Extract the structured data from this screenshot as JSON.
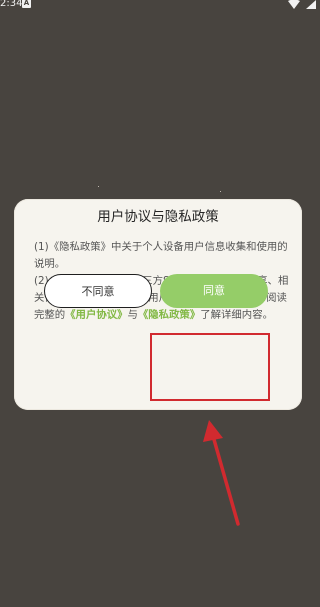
{
  "status_bar": {
    "time": "2:34",
    "app_icon_letter": "A"
  },
  "dialog": {
    "title": "用户协议与隐私政策",
    "paragraph1": "(1)《隐私政策》中关于个人设备用户信息收集和使用的说明。",
    "paragraph2_prefix": "(2)《隐私政策》中与第三方SDK类服务商数据共享、相关信息收集和使用说明。用户协议和隐私政策说明:阅读完整的",
    "user_agreement_link": "《用户协议》",
    "connector": "与",
    "privacy_policy_link": "《隐私政策》",
    "paragraph2_suffix": "了解详细内容。",
    "decline_button": "不同意",
    "agree_button": "同意"
  },
  "colors": {
    "background": "#48443f",
    "dialog_bg": "#f6f4ee",
    "accent_green": "#83b946",
    "agree_button": "#95cd68",
    "highlight_red": "#d12a2f"
  },
  "icons": [
    "wifi-icon",
    "signal-icon",
    "app-notification-icon",
    "arrow-annotation-icon"
  ]
}
